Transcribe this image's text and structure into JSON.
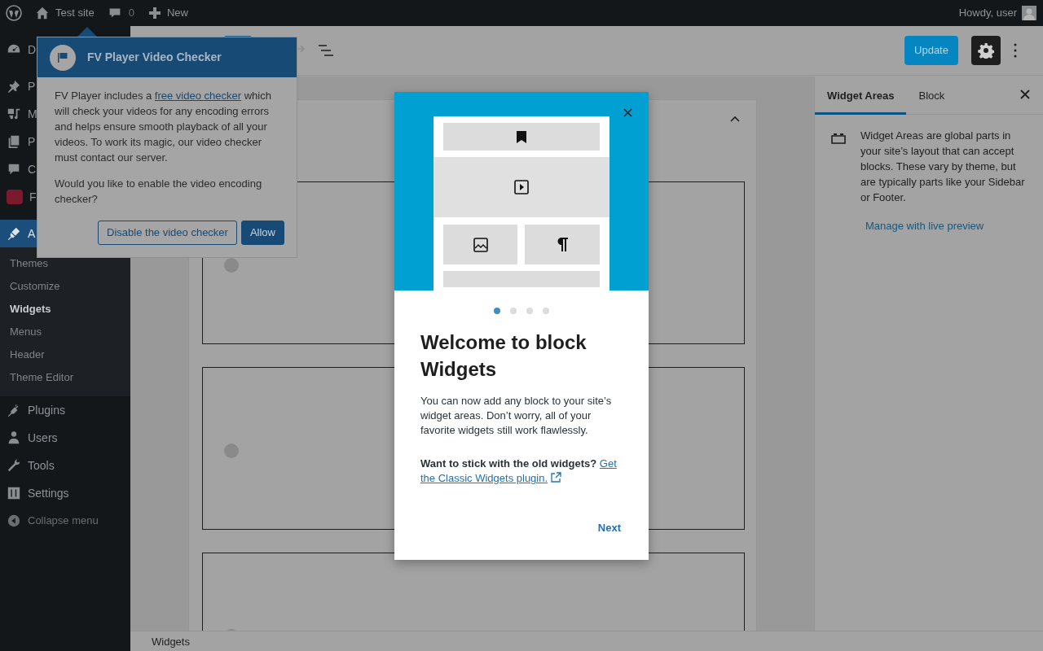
{
  "admin_bar": {
    "site": "Test site",
    "comments": "0",
    "new": "New",
    "greeting": "Howdy, user"
  },
  "sidebar": {
    "items": [
      {
        "label": "D",
        "selected": false
      },
      {
        "label": "P",
        "selected": false
      },
      {
        "label": "M",
        "selected": false
      },
      {
        "label": "P",
        "selected": false
      },
      {
        "label": "C",
        "selected": false
      },
      {
        "label": "F",
        "selected": false
      },
      {
        "label": "A",
        "selected": true,
        "children": [
          {
            "label": "Themes",
            "selected": false
          },
          {
            "label": "Customize",
            "selected": false
          },
          {
            "label": "Widgets",
            "selected": true
          },
          {
            "label": "Menus",
            "selected": false
          },
          {
            "label": "Header",
            "selected": false
          },
          {
            "label": "Theme Editor",
            "selected": false
          }
        ]
      },
      {
        "label": "Plugins",
        "selected": false
      },
      {
        "label": "Users",
        "selected": false
      },
      {
        "label": "Tools",
        "selected": false
      },
      {
        "label": "Settings",
        "selected": false
      },
      {
        "label": "Collapse menu",
        "selected": false
      }
    ]
  },
  "pointer": {
    "title": "FV Player Video Checker",
    "body_start": "FV Player includes a",
    "link": "free video checker",
    "body_end": "which will check your videos for any encoding errors and helps ensure smooth playback of all your videos. To work its magic, our video checker must contact our server.",
    "question": "Would you like to enable the video encoding checker?",
    "buttons": [
      {
        "label": "Disable the video checker",
        "kind": "secondary"
      },
      {
        "label": "Allow",
        "kind": "primary"
      }
    ]
  },
  "toolbar": {
    "update": "Update"
  },
  "sidebar_panel": {
    "tabs": [
      {
        "label": "Widget Areas",
        "selected": true
      },
      {
        "label": "Block",
        "selected": false
      }
    ],
    "description": "Widget Areas are global parts in your site’s layout that can accept blocks. These vary by theme, but are typically parts like your Sidebar or Footer.",
    "link": "Manage with live preview"
  },
  "footer": {
    "breadcrumb": "Widgets"
  },
  "guide": {
    "pages": [
      {
        "selected": true
      },
      {
        "selected": false
      },
      {
        "selected": false
      },
      {
        "selected": false
      }
    ],
    "title": "Welcome to block Widgets",
    "text": "You can now add any block to your site’s widget areas. Don’t worry, all of your favorite widgets still work flawlessly.",
    "question": "Want to stick with the old widgets?",
    "link_lines": [
      "Get",
      "the Classic Widgets plugin."
    ],
    "next": "Next"
  }
}
